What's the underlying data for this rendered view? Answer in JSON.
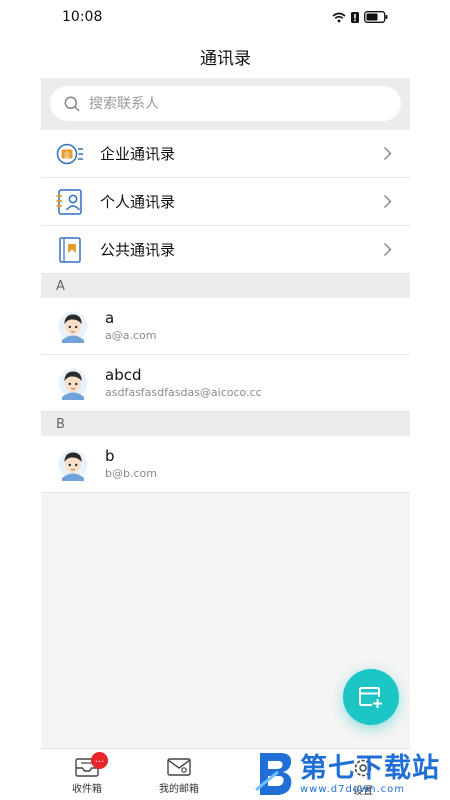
{
  "status_bar": {
    "time": "10:08"
  },
  "header": {
    "title": "通讯录"
  },
  "search": {
    "placeholder": "搜索联系人"
  },
  "directories": [
    {
      "label": "企业通讯录",
      "icon": "enterprise-contacts-icon"
    },
    {
      "label": "个人通讯录",
      "icon": "personal-contacts-icon"
    },
    {
      "label": "公共通讯录",
      "icon": "public-contacts-icon"
    }
  ],
  "sections": [
    {
      "letter": "A",
      "contacts": [
        {
          "name": "a",
          "email": "a@a.com"
        },
        {
          "name": "abcd",
          "email": "asdfasfasdfasdas@aicoco.cc"
        }
      ]
    },
    {
      "letter": "B",
      "contacts": [
        {
          "name": "b",
          "email": "b@b.com"
        }
      ]
    }
  ],
  "tabs": [
    {
      "label": "收件箱",
      "badge": "..."
    },
    {
      "label": "我的邮箱"
    },
    {
      "label": ""
    },
    {
      "label": "设置"
    }
  ],
  "watermark": {
    "title": "第七下载站",
    "url": "www.d7down.com"
  },
  "colors": {
    "accent": "#1cc6c4",
    "icon_blue": "#2f6fbf",
    "icon_orange": "#e89a2a",
    "badge": "#e8262b",
    "watermark": "#1f6fd6"
  }
}
